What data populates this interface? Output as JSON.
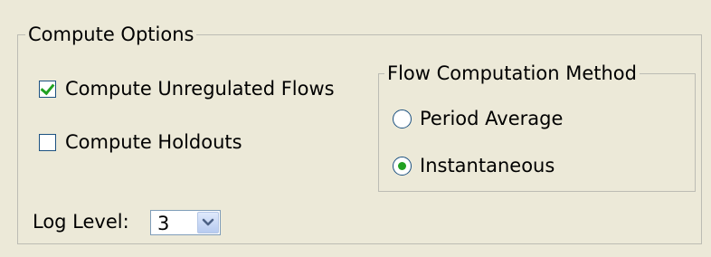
{
  "compute_options": {
    "title": "Compute Options",
    "unregulated": {
      "label": "Compute Unregulated Flows",
      "checked": true
    },
    "holdouts": {
      "label": "Compute Holdouts",
      "checked": false
    },
    "log_level": {
      "label": "Log Level:",
      "value": "3"
    }
  },
  "flow_method": {
    "title": "Flow Computation Method",
    "options": [
      {
        "label": "Period Average",
        "selected": false
      },
      {
        "label": "Instantaneous",
        "selected": true
      }
    ]
  },
  "colors": {
    "accent": "#21a121",
    "control_border": "#1c5180",
    "background": "#ece9d8"
  },
  "icons": {
    "dropdown": "chevron-down-icon",
    "check": "checkmark-icon",
    "radio": "radio-dot-icon"
  }
}
